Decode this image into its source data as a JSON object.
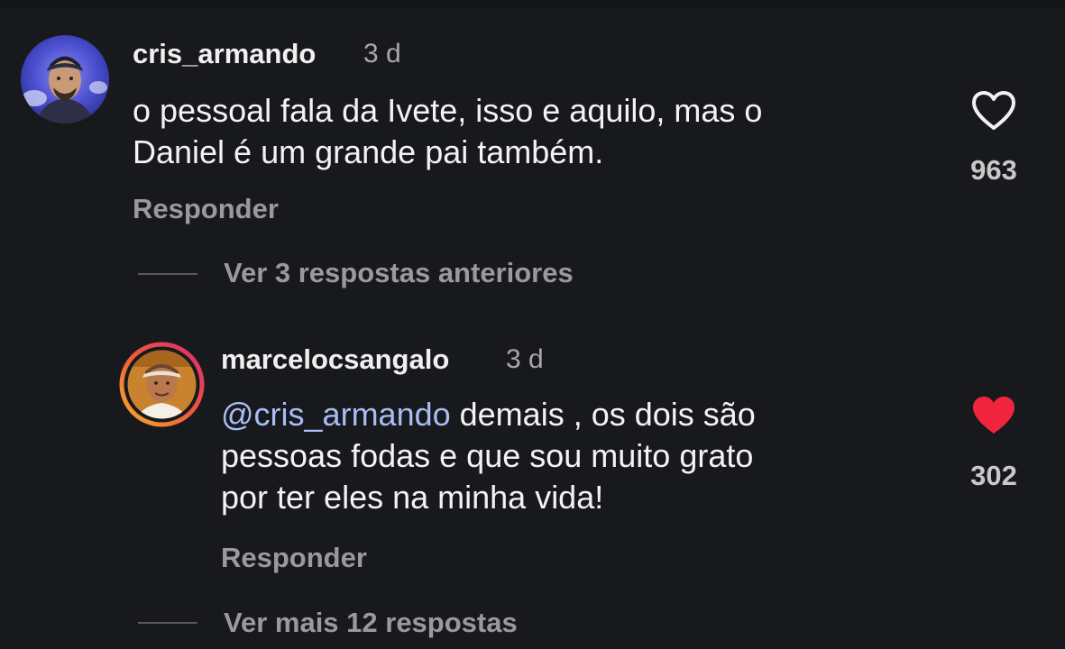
{
  "comment": {
    "username": "cris_armando",
    "time": "3 d",
    "text_lines": [
      "o pessoal fala da Ivete, isso e aquilo, mas o",
      "Daniel é um grande pai também."
    ],
    "reply_label": "Responder",
    "likes": "963",
    "liked": false,
    "avatar_icon": "user-avatar-icon"
  },
  "previous_replies": {
    "label": "Ver 3 respostas anteriores"
  },
  "reply": {
    "username": "marcelocsangalo",
    "time": "3 d",
    "mention": "@cris_armando",
    "text_lines": [
      " demais , os dois são",
      "pessoas fodas e que sou muito grato",
      "por ter eles na minha vida!"
    ],
    "reply_label": "Responder",
    "likes": "302",
    "liked": true,
    "avatar_icon": "story-ring-avatar-icon"
  },
  "more_replies": {
    "label": "Ver mais 12 respostas"
  },
  "colors": {
    "background": "#18191d",
    "mention": "#a9bdf5",
    "liked_heart": "#f0243c",
    "story_ring_start": "#f7b42c",
    "story_ring_end": "#d62976"
  }
}
